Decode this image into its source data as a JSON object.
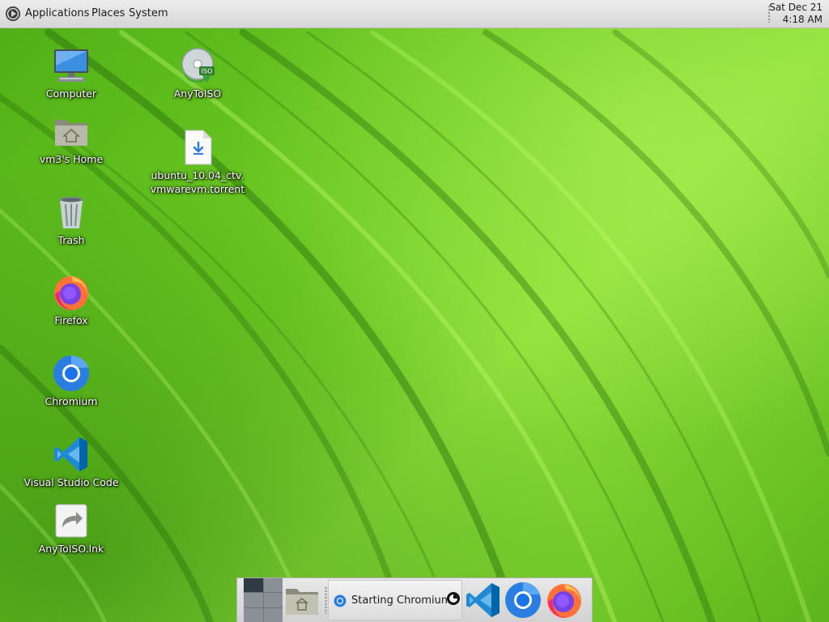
{
  "top_panel": {
    "menus": [
      "Applications",
      "Places",
      "System"
    ],
    "clock": {
      "date": "Sat Dec 21",
      "time": "4:18 AM"
    }
  },
  "desktop": {
    "icons": [
      {
        "label": "Computer",
        "icon": "computer-icon"
      },
      {
        "label": "vm3's Home",
        "icon": "home-folder-icon"
      },
      {
        "label": "Trash",
        "icon": "trash-icon"
      },
      {
        "label": "Firefox",
        "icon": "firefox-icon"
      },
      {
        "label": "Chromium",
        "icon": "chromium-icon"
      },
      {
        "label": "Visual Studio Code",
        "icon": "vscode-icon"
      },
      {
        "label": "AnyToISO.lnk",
        "icon": "shortcut-icon"
      },
      {
        "label": "AnyToISO",
        "icon": "anytoiso-icon"
      },
      {
        "label": "ubuntu_10.04_ctv.vmwarevm.torrent",
        "icon": "torrent-file-icon"
      }
    ]
  },
  "dock": {
    "task": {
      "label": "Starting Chromium",
      "icon": "chromium-icon"
    },
    "launchers": [
      "vscode-icon",
      "chromium-icon",
      "firefox-icon"
    ],
    "workspaces": {
      "count": 6,
      "active": 0
    }
  },
  "colors": {
    "wallpaper": "#6fcc24",
    "panel": "#e0e0e0",
    "label_text": "#ffffff"
  }
}
